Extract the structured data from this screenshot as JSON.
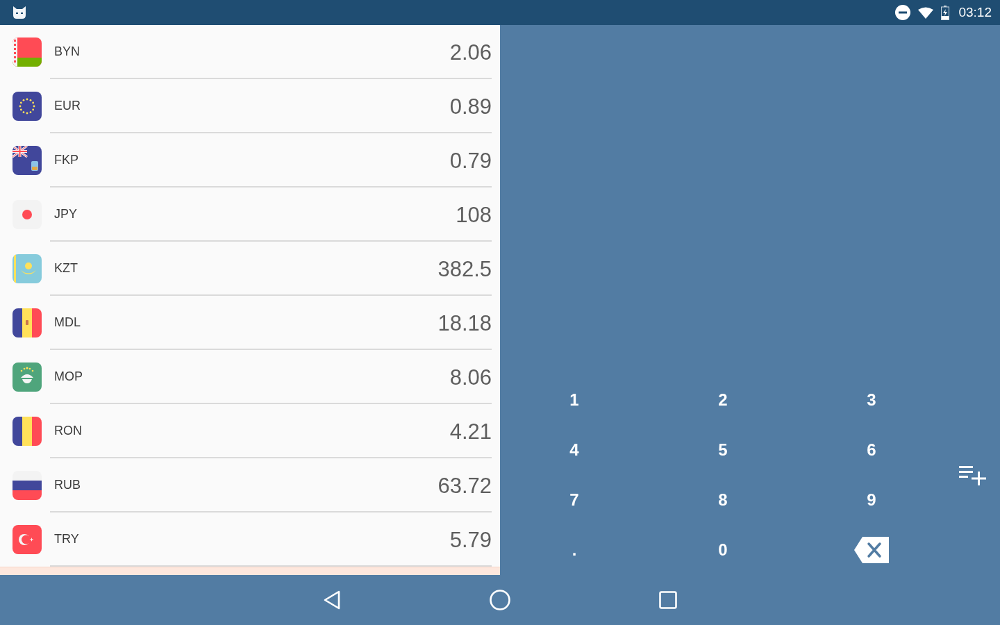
{
  "status_bar": {
    "time": "03:12"
  },
  "currencies": [
    {
      "code": "BYN",
      "value": "2.06",
      "kind": "belarus"
    },
    {
      "code": "EUR",
      "value": "0.89",
      "kind": "europe"
    },
    {
      "code": "FKP",
      "value": "0.79",
      "kind": "falklands"
    },
    {
      "code": "JPY",
      "value": "108",
      "kind": "japan"
    },
    {
      "code": "KZT",
      "value": "382.5",
      "kind": "kazakhstan"
    },
    {
      "code": "MDL",
      "value": "18.18",
      "kind": "moldova"
    },
    {
      "code": "MOP",
      "value": "8.06",
      "kind": "macau"
    },
    {
      "code": "RON",
      "value": "4.21",
      "kind": "romania"
    },
    {
      "code": "RUB",
      "value": "63.72",
      "kind": "russia"
    },
    {
      "code": "TRY",
      "value": "5.79",
      "kind": "turkey"
    }
  ],
  "keypad": [
    {
      "kind": "digit",
      "label": "1"
    },
    {
      "kind": "digit",
      "label": "2"
    },
    {
      "kind": "digit",
      "label": "3"
    },
    {
      "kind": "digit",
      "label": "4"
    },
    {
      "kind": "digit",
      "label": "5"
    },
    {
      "kind": "digit",
      "label": "6"
    },
    {
      "kind": "digit",
      "label": "7"
    },
    {
      "kind": "digit",
      "label": "8"
    },
    {
      "kind": "digit",
      "label": "9"
    },
    {
      "kind": "digit",
      "label": "."
    },
    {
      "kind": "digit",
      "label": "0"
    },
    {
      "kind": "backspace"
    }
  ]
}
